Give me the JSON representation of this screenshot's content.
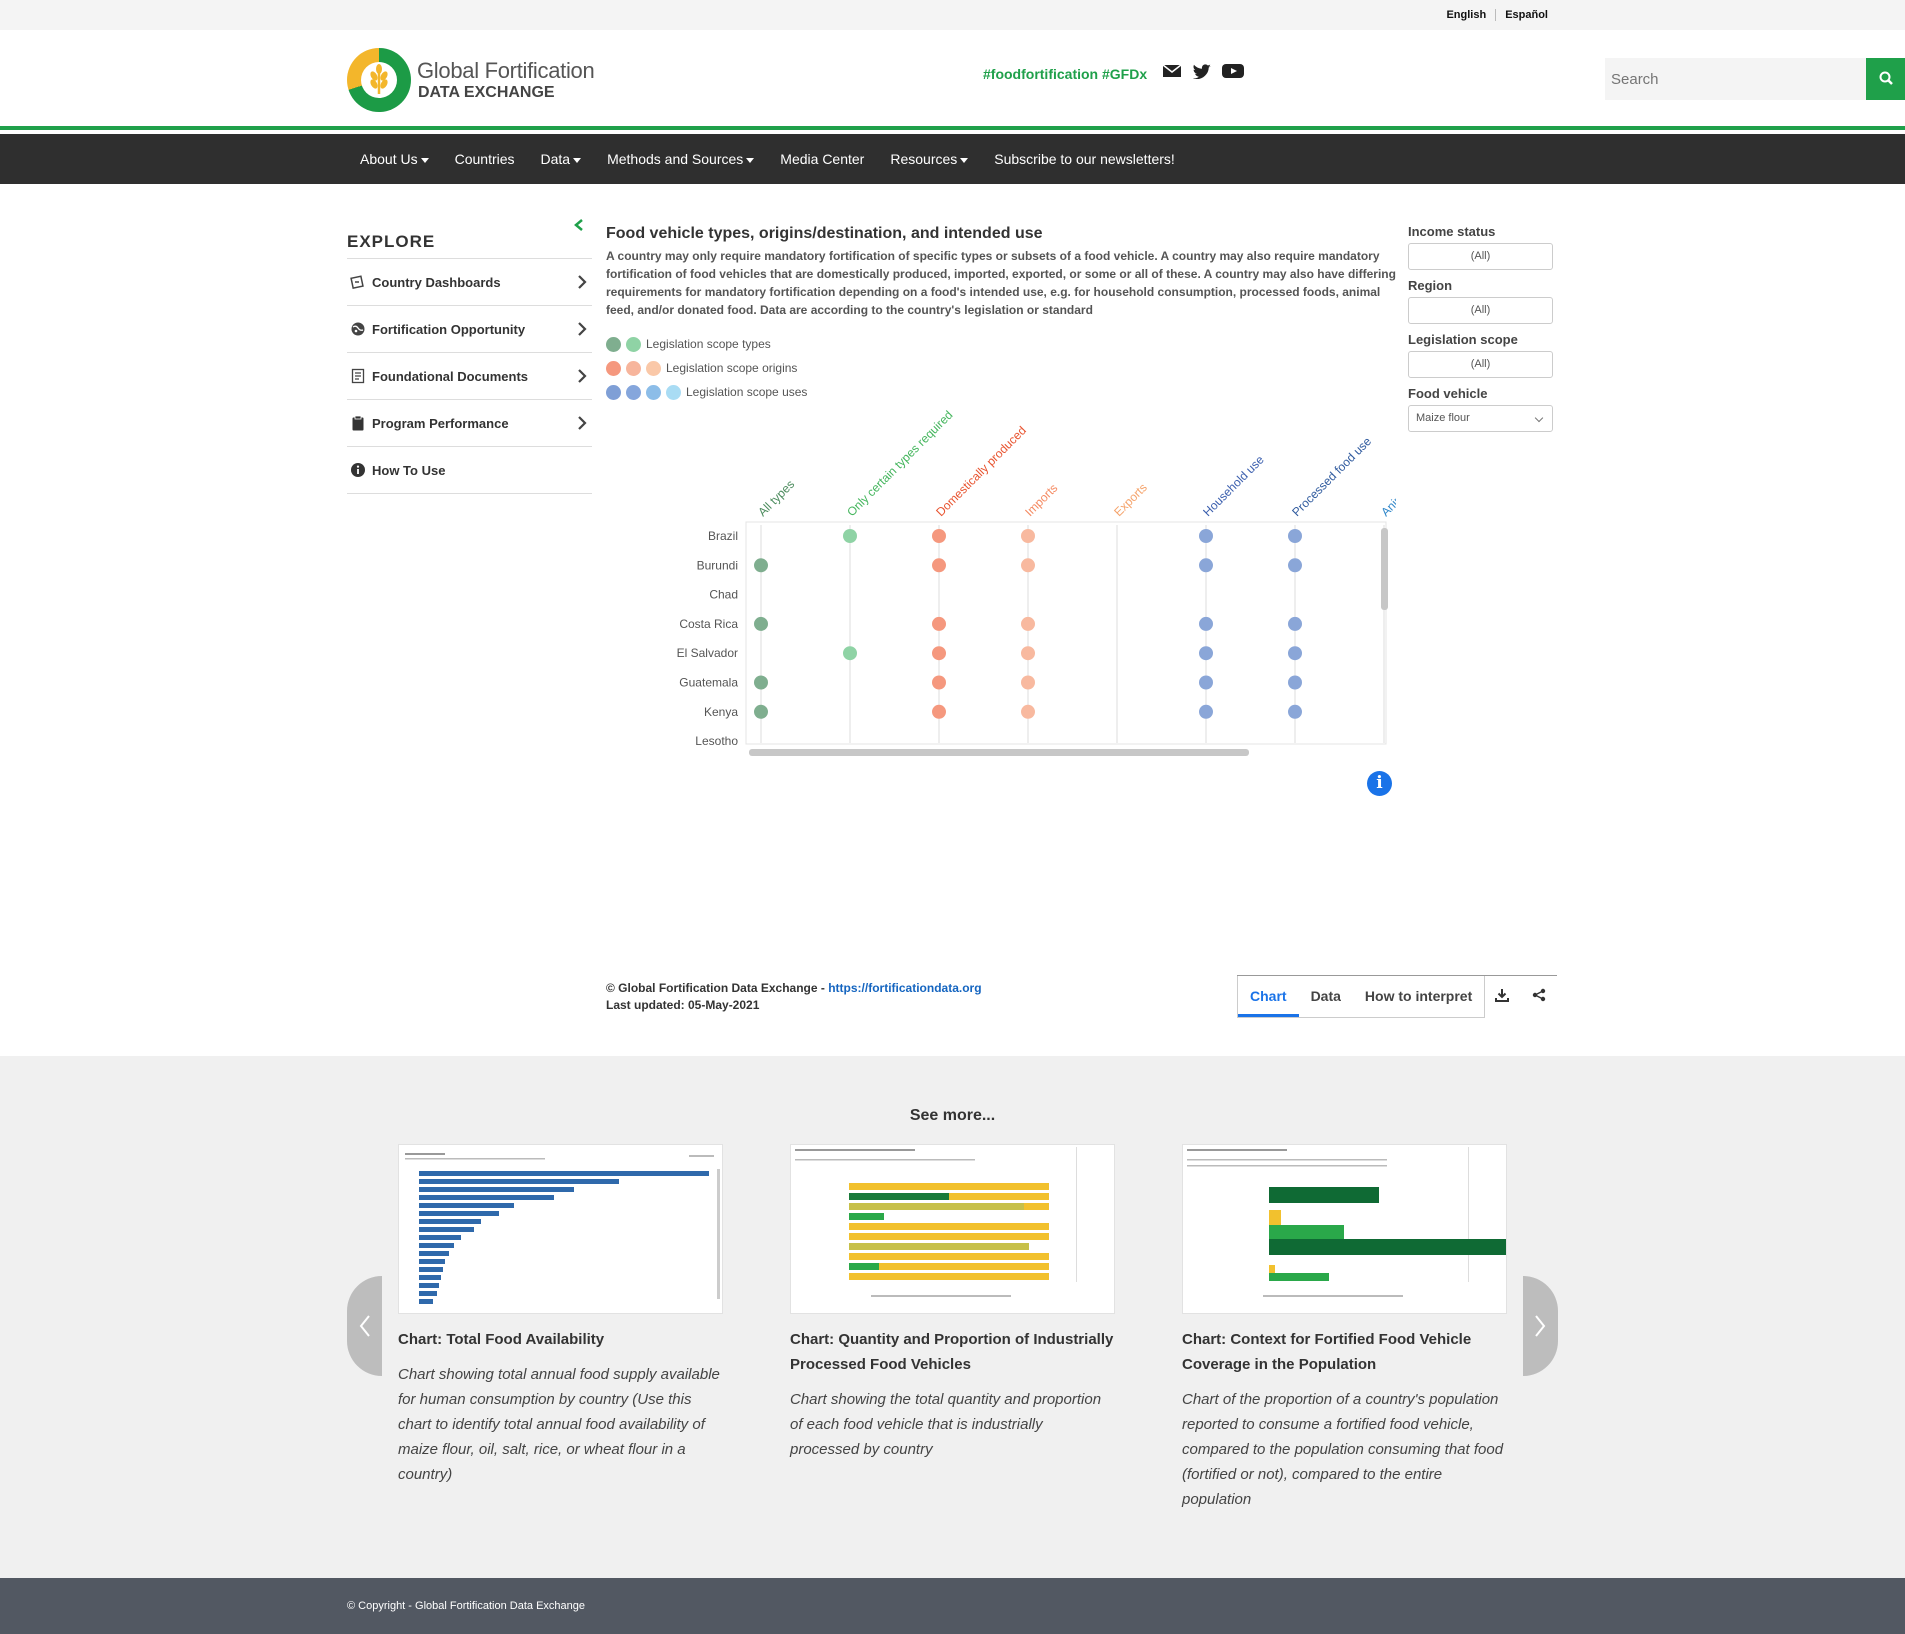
{
  "lang": {
    "english": "English",
    "espanol": "Español"
  },
  "header": {
    "logo_line1": "Global Fortification",
    "logo_line2": "DATA EXCHANGE",
    "hashtags": "#foodfortification #GFDx",
    "search_placeholder": "Search"
  },
  "nav": {
    "items": [
      {
        "label": "About Us",
        "dropdown": true
      },
      {
        "label": "Countries",
        "dropdown": false
      },
      {
        "label": "Data",
        "dropdown": true
      },
      {
        "label": "Methods and Sources",
        "dropdown": true
      },
      {
        "label": "Media Center",
        "dropdown": false
      },
      {
        "label": "Resources",
        "dropdown": true
      },
      {
        "label": "Subscribe to our newsletters!",
        "dropdown": false
      }
    ]
  },
  "sidebar": {
    "heading": "EXPLORE",
    "items": [
      {
        "label": "Country Dashboards",
        "icon": "dashboard-icon",
        "chevron": true
      },
      {
        "label": "Fortification Opportunity",
        "icon": "globe-icon",
        "chevron": true
      },
      {
        "label": "Foundational Documents",
        "icon": "document-icon",
        "chevron": true
      },
      {
        "label": "Program Performance",
        "icon": "clipboard-icon",
        "chevron": true
      },
      {
        "label": "How To Use",
        "icon": "info-icon",
        "chevron": false
      }
    ]
  },
  "main": {
    "title": "Food vehicle types, origins/destination, and intended use",
    "description": "A country may only require mandatory fortification of specific types or subsets of a food vehicle. A country may also require mandatory fortification of food vehicles that are domestically produced, imported, exported, or some or all of these. A country may also have differing requirements for mandatory fortification depending on a food's intended use, e.g. for household consumption, processed foods, animal feed, and/or donated food. Data are according to the country's legislation or standard",
    "legend": [
      {
        "label": "Legislation scope types",
        "colors": [
          "#7fae8f",
          "#8fd3a5"
        ]
      },
      {
        "label": "Legislation scope origins",
        "colors": [
          "#f5987e",
          "#f7b59c",
          "#fac8a8"
        ]
      },
      {
        "label": "Legislation scope uses",
        "colors": [
          "#7f9fd6",
          "#85a6dc",
          "#8cbde8",
          "#a9dcf4"
        ]
      }
    ]
  },
  "chart_data": {
    "type": "scatter",
    "columns": [
      {
        "label": "All types",
        "color": "#4c8c5e",
        "dot": "#7fae8f"
      },
      {
        "label": "Only certain types required",
        "color": "#43b55c",
        "dot": "#8fd3a5"
      },
      {
        "label": "Domestically produced",
        "color": "#e8532f",
        "dot": "#f5987e"
      },
      {
        "label": "Imports",
        "color": "#f58a62",
        "dot": "#f8b99f"
      },
      {
        "label": "Exports",
        "color": "#f5a36b",
        "dot": "#fac8a8"
      },
      {
        "label": "Household use",
        "color": "#3b5fae",
        "dot": "#8aa6d8"
      },
      {
        "label": "Processed food use",
        "color": "#2f5a9e",
        "dot": "#8aa6d8"
      },
      {
        "label": "Anim",
        "color": "#2f86c9",
        "dot": "#8cbde8"
      }
    ],
    "rows": [
      {
        "country": "Brazil",
        "values": [
          0,
          1,
          1,
          1,
          0,
          1,
          1,
          0
        ]
      },
      {
        "country": "Burundi",
        "values": [
          1,
          0,
          1,
          1,
          0,
          1,
          1,
          0
        ]
      },
      {
        "country": "Chad",
        "values": [
          0,
          0,
          0,
          0,
          0,
          0,
          0,
          0
        ]
      },
      {
        "country": "Costa Rica",
        "values": [
          1,
          0,
          1,
          1,
          0,
          1,
          1,
          0
        ]
      },
      {
        "country": "El Salvador",
        "values": [
          0,
          1,
          1,
          1,
          0,
          1,
          1,
          0
        ]
      },
      {
        "country": "Guatemala",
        "values": [
          1,
          0,
          1,
          1,
          0,
          1,
          1,
          0
        ]
      },
      {
        "country": "Kenya",
        "values": [
          1,
          0,
          1,
          1,
          0,
          1,
          1,
          0
        ]
      },
      {
        "country": "Lesotho",
        "values": [
          0,
          0,
          0,
          0,
          0,
          0,
          0,
          0
        ]
      }
    ]
  },
  "filters": {
    "income_label": "Income status",
    "income_value": "(All)",
    "region_label": "Region",
    "region_value": "(All)",
    "scope_label": "Legislation scope",
    "scope_value": "(All)",
    "vehicle_label": "Food vehicle",
    "vehicle_value": "Maize flour"
  },
  "credits": {
    "copyright": "© Global Fortification Data Exchange - ",
    "link": "https://fortificationdata.org",
    "updated": "Last updated: 05-May-2021"
  },
  "tabs": {
    "chart": "Chart",
    "data": "Data",
    "how": "How to interpret"
  },
  "info_glyph": "i",
  "seemore": {
    "title": "See more...",
    "cards": [
      {
        "title": "Chart: Total Food Availability",
        "desc": "Chart showing total annual food supply available for human consumption by country (Use this chart to identify total annual food availability of maize flour, oil, salt, rice, or wheat flour in a country)"
      },
      {
        "title": "Chart: Quantity and Proportion of Industrially Processed Food Vehicles",
        "desc": "Chart showing the total quantity and proportion of each food vehicle that is industrially processed by country"
      },
      {
        "title": "Chart: Context for Fortified Food Vehicle Coverage in the Population",
        "desc": "Chart of the proportion of a country's population reported to consume a fortified food vehicle, compared to the population consuming that food (fortified or not), compared to the entire population"
      }
    ]
  },
  "footer": {
    "copyright": "© Copyright - Global Fortification Data Exchange"
  }
}
